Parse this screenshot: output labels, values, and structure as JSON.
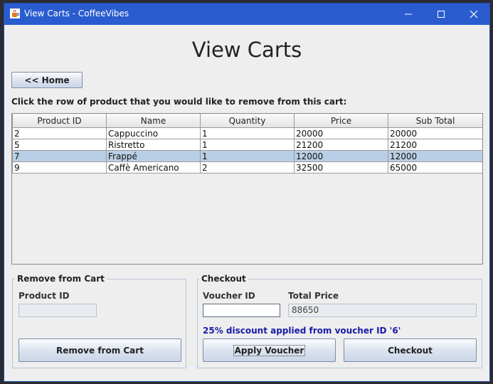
{
  "window": {
    "title": "View Carts - CoffeeVibes"
  },
  "page": {
    "heading": "View Carts",
    "home_label": "<< Home",
    "instruction": "Click the row of product that you would like to remove from this cart:"
  },
  "table": {
    "columns": [
      "Product ID",
      "Name",
      "Quantity",
      "Price",
      "Sub Total"
    ],
    "rows": [
      [
        "2",
        "Cappuccino",
        "1",
        "20000",
        "20000"
      ],
      [
        "5",
        "Ristretto",
        "1",
        "21200",
        "21200"
      ],
      [
        "7",
        "Frappé",
        "1",
        "12000",
        "12000"
      ],
      [
        "9",
        "Caffè Americano",
        "2",
        "32500",
        "65000"
      ]
    ],
    "selected_row": 2
  },
  "remove": {
    "title": "Remove from Cart",
    "product_id_label": "Product ID",
    "product_id_value": "",
    "button_label": "Remove from Cart"
  },
  "checkout": {
    "title": "Checkout",
    "voucher_label": "Voucher ID",
    "voucher_value": "",
    "total_label": "Total Price",
    "total_value": "88650",
    "message": "25% discount applied from voucher ID '6'",
    "apply_label": "Apply Voucher",
    "checkout_label": "Checkout"
  },
  "colors": {
    "titlebar": "#2a5ccf",
    "selection": "#b9cfe5",
    "message": "#1a1aa8"
  },
  "icons": {
    "app": "java-cup-icon",
    "minimize": "minimize-icon",
    "maximize": "maximize-icon",
    "close": "close-icon"
  }
}
